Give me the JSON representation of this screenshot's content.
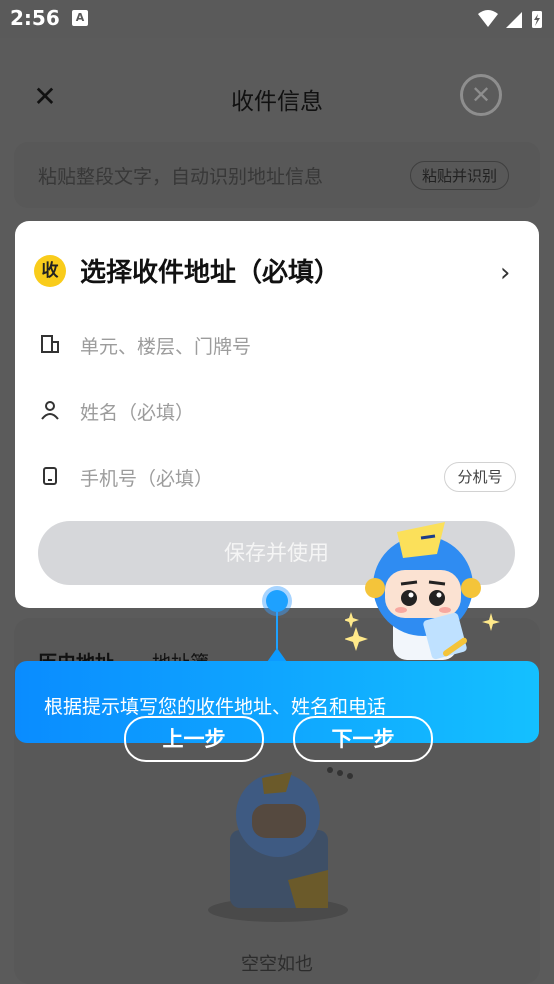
{
  "status_bar": {
    "time": "2:56",
    "a_icon": "A"
  },
  "nav": {
    "close_glyph": "✕",
    "title": "收件信息",
    "ring_glyph": "✕"
  },
  "paste": {
    "placeholder": "粘贴整段文字，自动识别地址信息",
    "button": "粘贴并识别"
  },
  "address_card": {
    "badge": "收",
    "title": "选择收件地址（必填）",
    "chevron": "›",
    "fields": {
      "unit": "单元、楼层、门牌号",
      "name": "姓名（必填）",
      "phone": "手机号（必填）"
    },
    "extension_button": "分机号",
    "save_button": "保存并使用"
  },
  "history": {
    "tab1": "历史地址",
    "tab2": "地址簿",
    "empty_text": "空空如也"
  },
  "guide": {
    "tip": "根据提示填写您的收件地址、姓名和电话",
    "prev": "上一步",
    "next": "下一步"
  },
  "colors": {
    "accent": "#1ea1ff",
    "badge": "#f9cc1b",
    "overlay": "#5a5a5a"
  }
}
